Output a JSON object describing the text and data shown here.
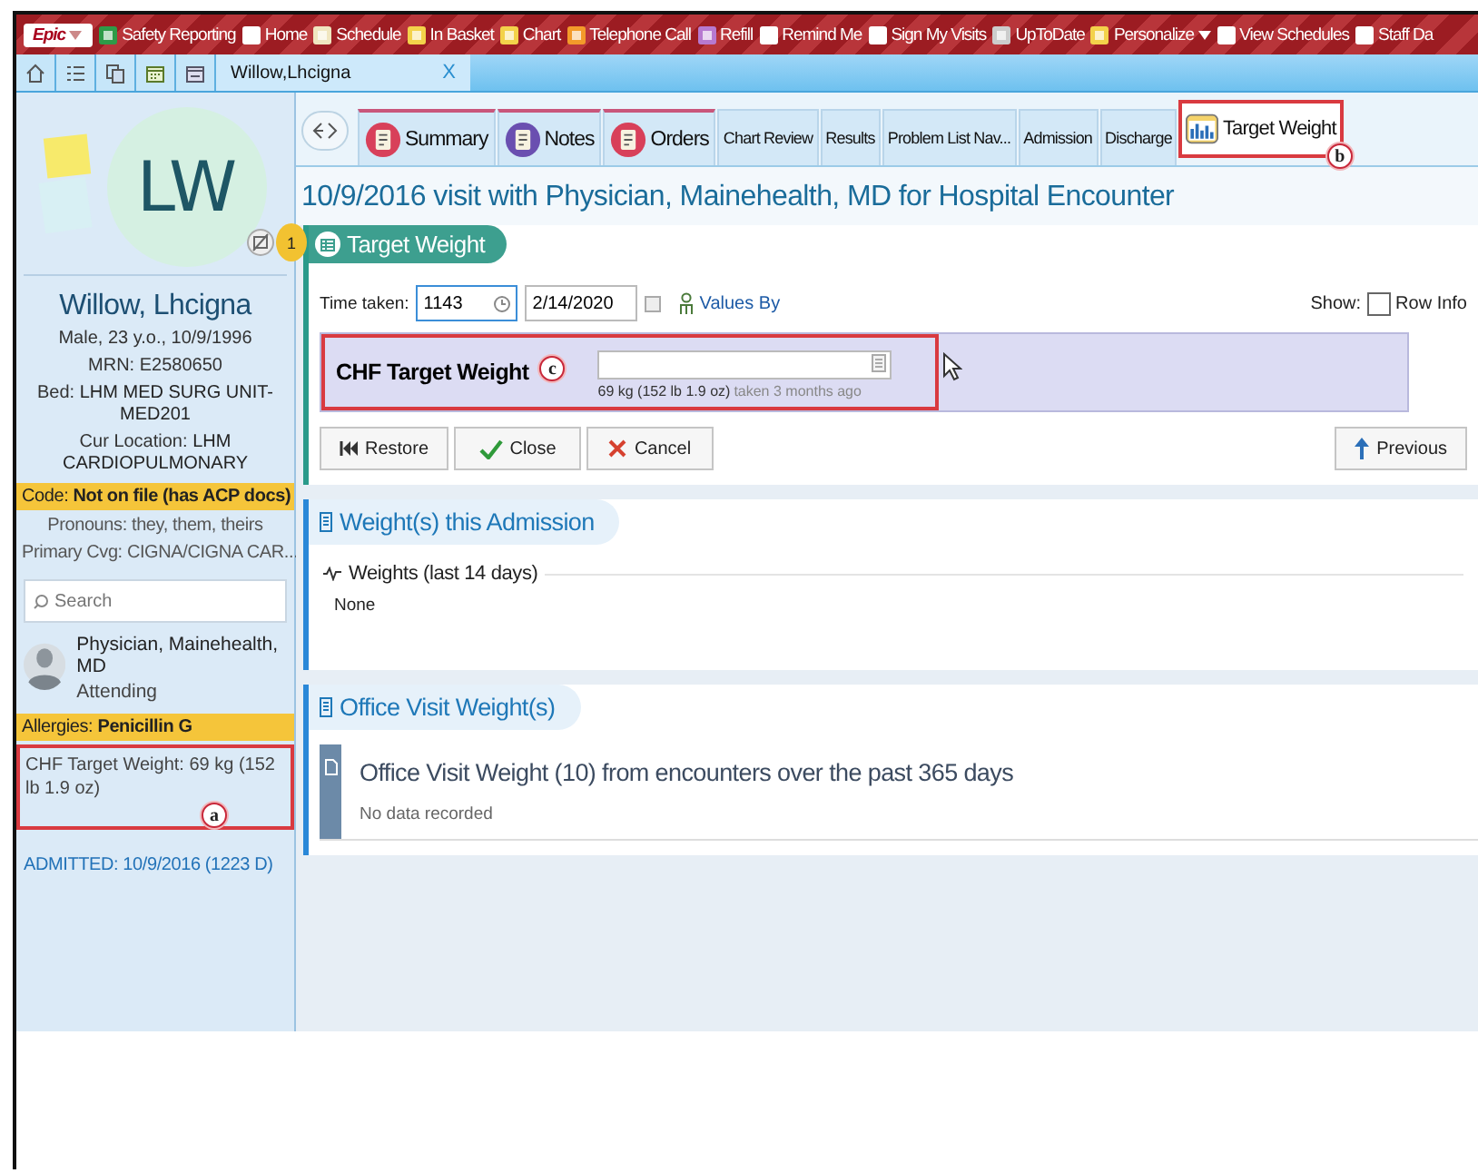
{
  "toolbar": {
    "logo": "Epic",
    "items": [
      {
        "label": "Safety Reporting",
        "dropdown": false
      },
      {
        "label": "Home",
        "dropdown": false
      },
      {
        "label": "Schedule",
        "dropdown": false
      },
      {
        "label": "In Basket",
        "dropdown": false
      },
      {
        "label": "Chart",
        "dropdown": false
      },
      {
        "label": "Telephone Call",
        "dropdown": false
      },
      {
        "label": "Refill",
        "dropdown": false
      },
      {
        "label": "Remind Me",
        "dropdown": false
      },
      {
        "label": "Sign My Visits",
        "dropdown": false
      },
      {
        "label": "UpToDate",
        "dropdown": false
      },
      {
        "label": "Personalize",
        "dropdown": true
      },
      {
        "label": "View Schedules",
        "dropdown": false
      },
      {
        "label": "Staff Da",
        "dropdown": false
      }
    ]
  },
  "patient_tab": {
    "title": "Willow,Lhcigna",
    "close": "X"
  },
  "sidebar": {
    "initials": "LW",
    "flag_count": "1",
    "name": "Willow, Lhcigna",
    "details": [
      "Male, 23 y.o., 10/9/1996",
      "MRN: E2580650",
      "Bed: **LHM MED SURG UNIT-MED201**",
      "Cur Location: **LHM CARDIOPULMONARY**"
    ],
    "code": "Code: **Not on file (has ACP docs)**",
    "more": [
      "Pronouns: they, them, theirs",
      "Primary Cvg: CIGNA/CIGNA CAR..."
    ],
    "search": {
      "placeholder": "Search"
    },
    "provider": {
      "name": "Physician, Mainehealth, MD",
      "role": "Attending"
    },
    "allergies": "Allergies: **Penicillin G**",
    "target_weight": {
      "text": "CHF Target Weight: 69 kg (152 lb 1.9 oz)",
      "callout": "a"
    },
    "admitted": "ADMITTED: 10/9/2016 (1223 D)"
  },
  "tabs": [
    {
      "label": "Summary",
      "kind": "round",
      "color": "#d8405a",
      "selected": false
    },
    {
      "label": "Notes",
      "kind": "round",
      "color": "#6a4fb0",
      "selected": false
    },
    {
      "label": "Orders",
      "kind": "round",
      "color": "#d8405a",
      "selected": false
    },
    {
      "label": "Chart Review",
      "kind": "plain",
      "selected": false
    },
    {
      "label": "Results",
      "kind": "plain",
      "selected": false
    },
    {
      "label": "Problem List Nav...",
      "kind": "plain",
      "selected": false
    },
    {
      "label": "Admission",
      "kind": "plain",
      "selected": false
    },
    {
      "label": "Discharge",
      "kind": "plain",
      "selected": false
    },
    {
      "label": "Target Weight",
      "kind": "chart",
      "selected": true,
      "callout": "b"
    }
  ],
  "heading": "10/9/2016 visit with Physician, Mainehealth, MD for Hospital Encounter",
  "target_weight_section": {
    "title": "Target Weight",
    "time_label": "Time taken:",
    "time": "1143",
    "date": "2/14/2020",
    "values_by": "Values By",
    "show_label": "Show:",
    "row_info": {
      "label": "Row Info",
      "checked": false
    },
    "row": {
      "label": "CHF Target Weight",
      "callout": "c",
      "last_value": "69 kg (152 lb 1.9 oz)",
      "last_note": "taken 3 months ago"
    },
    "buttons": [
      {
        "label": "Restore",
        "kind": "restore"
      },
      {
        "label": "Close",
        "kind": "close"
      },
      {
        "label": "Cancel",
        "kind": "cancel"
      }
    ],
    "right_buttons": [
      {
        "label": "Previous",
        "kind": "previous"
      }
    ]
  },
  "admission_section": {
    "title": "Weight(s) this Admission",
    "subheading": "Weights (last 14 days)",
    "value": "None"
  },
  "office_section": {
    "title": "Office Visit Weight(s)",
    "card_title": "Office Visit Weight (10) from encounters over the past 365 days",
    "card_note": "No data recorded"
  }
}
